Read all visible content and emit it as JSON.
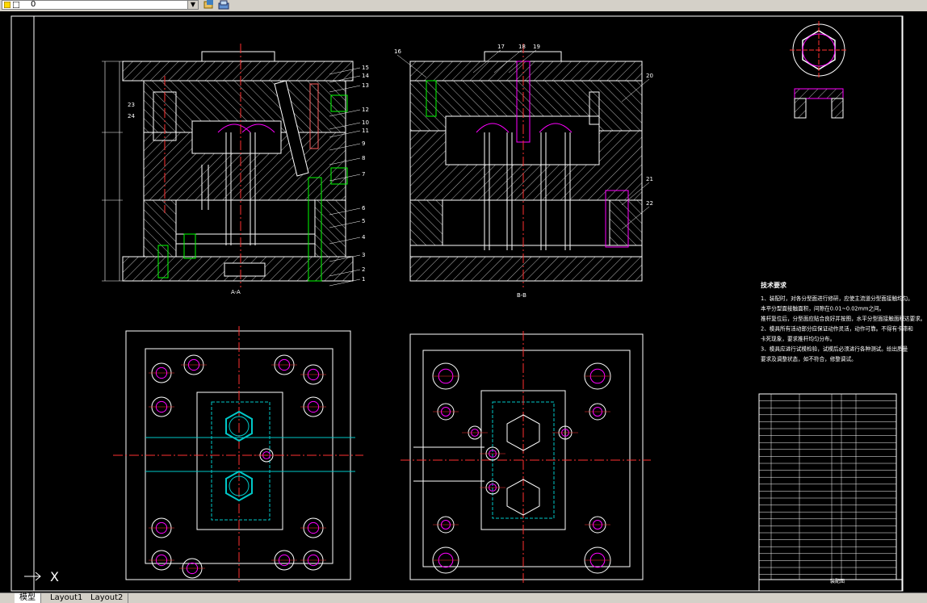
{
  "toolbar": {
    "layer_value": "0",
    "icons": [
      "layer-state-icon",
      "layer-lock-icon",
      "layer-previous-icon",
      "layer-properties-icon"
    ]
  },
  "drawing": {
    "section_a_label": "A-A",
    "section_b_label": "B-B",
    "callouts_left": [
      "15",
      "14",
      "13",
      "12",
      "10",
      "11",
      "9",
      "8",
      "7",
      "6",
      "5",
      "4",
      "3",
      "2",
      "1",
      "23",
      "24"
    ],
    "callouts_right": [
      "16",
      "17",
      "18",
      "19",
      "20",
      "21",
      "22"
    ],
    "tech_req_title": "技术要求",
    "tech_req_lines": [
      "1、装配时，对各分型面进行修研，应使主流道分型面接触均匀。",
      "本平分型面接触面积，间隙在0.01~0.02mm之间。",
      "推杆复位后，分型面应贴合良好并按图，水平分型面接触面积达要求。",
      "2、模具所有活动部分应保证动作灵活，动作可靠。不得有卡滞和",
      "卡死现象，要求推杆均匀分布。",
      "3、模具应进行试模检验，试模后必须进行各种测试。给出质量",
      "要求及调整状态，如不符合，修整调试。"
    ],
    "title_block_label": "装配图"
  },
  "tabs": [
    "模型",
    "Layout1",
    "Layout2"
  ],
  "ucs": {
    "x_label": "X"
  },
  "colors": {
    "background": "#000000",
    "outline": "#ffffff",
    "center": "#ff3030",
    "cyan": "#00c8c8",
    "magenta": "#ff00ff",
    "green": "#00ff00"
  }
}
